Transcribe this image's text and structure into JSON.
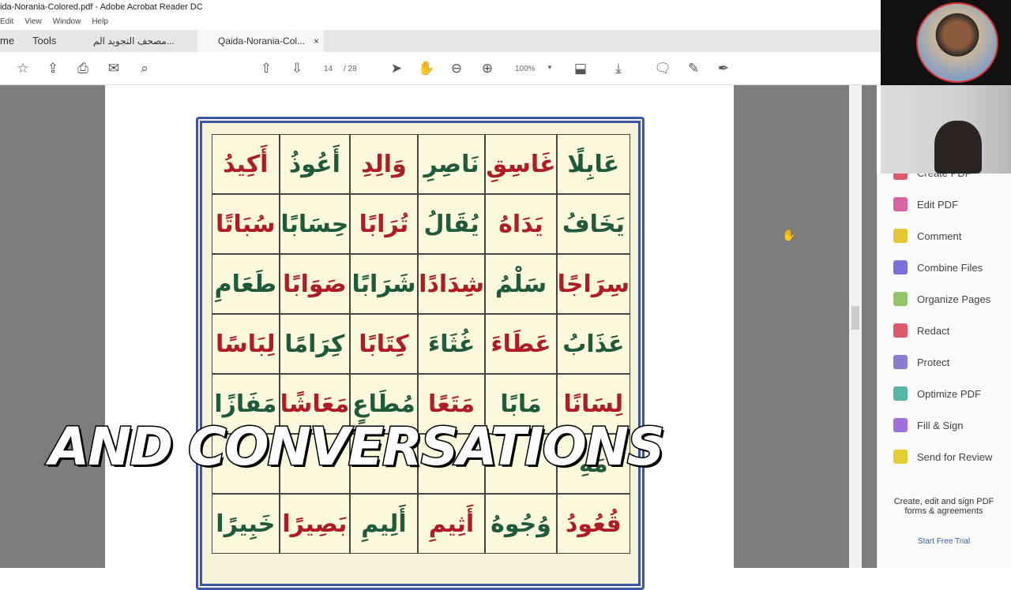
{
  "window": {
    "title": "ida-Norania-Colored.pdf - Adobe Acrobat Reader DC"
  },
  "menu": [
    "Edit",
    "View",
    "Window",
    "Help"
  ],
  "tabs": {
    "home": "me",
    "tools": "Tools",
    "doc1": "مصحف التجويد الم...",
    "doc2": "Qaida-Norania-Col...",
    "close": "×"
  },
  "toolbar": {
    "page_current": "14",
    "page_total": "/ 28",
    "zoom": "100%"
  },
  "grid": [
    [
      "عَابِلًا",
      "غَاسِقِ",
      "نَاصِرِ",
      "وَالِدِ",
      "أَعُوذُ",
      "أَكِيدُ"
    ],
    [
      "يَخَافُ",
      "يَدَاهُ",
      "يُقَالُ",
      "تُرَابًا",
      "حِسَابًا",
      "سُبَاتًا"
    ],
    [
      "سِرَاجًا",
      "سَلْمُ",
      "شِدَادًا",
      "شَرَابًا",
      "صَوَابًا",
      "طَعَامِ"
    ],
    [
      "عَذَابُ",
      "عَطَاءَ",
      "غُثَاءَ",
      "كِتَابًا",
      "كِرَامًا",
      "لِبَاسًا"
    ],
    [
      "لِسَانًا",
      "مَابًا",
      "مَتَعًا",
      "مُطَاعٍ",
      "مَعَاشًا",
      "مَفَازًا"
    ],
    [
      "مَهِ",
      "",
      "",
      "",
      "",
      ""
    ],
    [
      "قُعُودُ",
      "وُجُوهُ",
      "أَثِيمِ",
      "أَلِيمِ",
      "بَصِيرًا",
      "خَبِيرًا"
    ]
  ],
  "panel": {
    "items": [
      {
        "label": "Create PDF",
        "color": "#d9304a"
      },
      {
        "label": "Edit PDF",
        "color": "#d13d8e"
      },
      {
        "label": "Comment",
        "color": "#e0b800"
      },
      {
        "label": "Combine Files",
        "color": "#5a4fd6"
      },
      {
        "label": "Organize Pages",
        "color": "#7bb84a"
      },
      {
        "label": "Redact",
        "color": "#d9304a"
      },
      {
        "label": "Protect",
        "color": "#6b5fc7"
      },
      {
        "label": "Optimize PDF",
        "color": "#2aa88f"
      },
      {
        "label": "Fill & Sign",
        "color": "#8a4fd6"
      },
      {
        "label": "Send for Review",
        "color": "#e0c200"
      }
    ],
    "promo": "Create, edit and sign PDF forms & agreements",
    "trial": "Start Free Trial"
  },
  "caption": "AND CONVERSATIONS"
}
